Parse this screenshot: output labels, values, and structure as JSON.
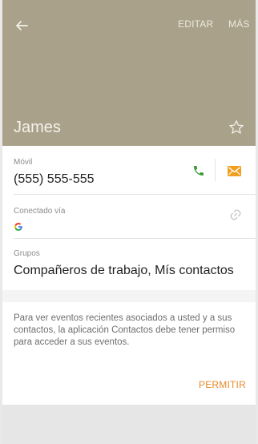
{
  "header": {
    "edit_label": "EDITAR",
    "more_label": "MÁS",
    "contact_name": "James",
    "background_color": "#a9a18a"
  },
  "details": {
    "phone": {
      "label": "Móvil",
      "value": "(555) 555-555",
      "call_icon": "phone-icon",
      "message_icon": "envelope-icon",
      "call_color": "#3a9b3a",
      "message_color": "#f0a020"
    },
    "connected": {
      "label": "Conectado vía",
      "account_icon": "google-icon",
      "link_icon": "link-icon"
    },
    "groups": {
      "label": "Grupos",
      "value": "Compañeros de trabajo, Mís contactos"
    }
  },
  "notice": {
    "text": "Para ver eventos recientes asociados a usted y a sus contactos, la aplicación Contactos debe tener permiso para acceder a sus eventos.",
    "permit_label": "PERMITIR",
    "accent_color": "#e58a2a"
  }
}
